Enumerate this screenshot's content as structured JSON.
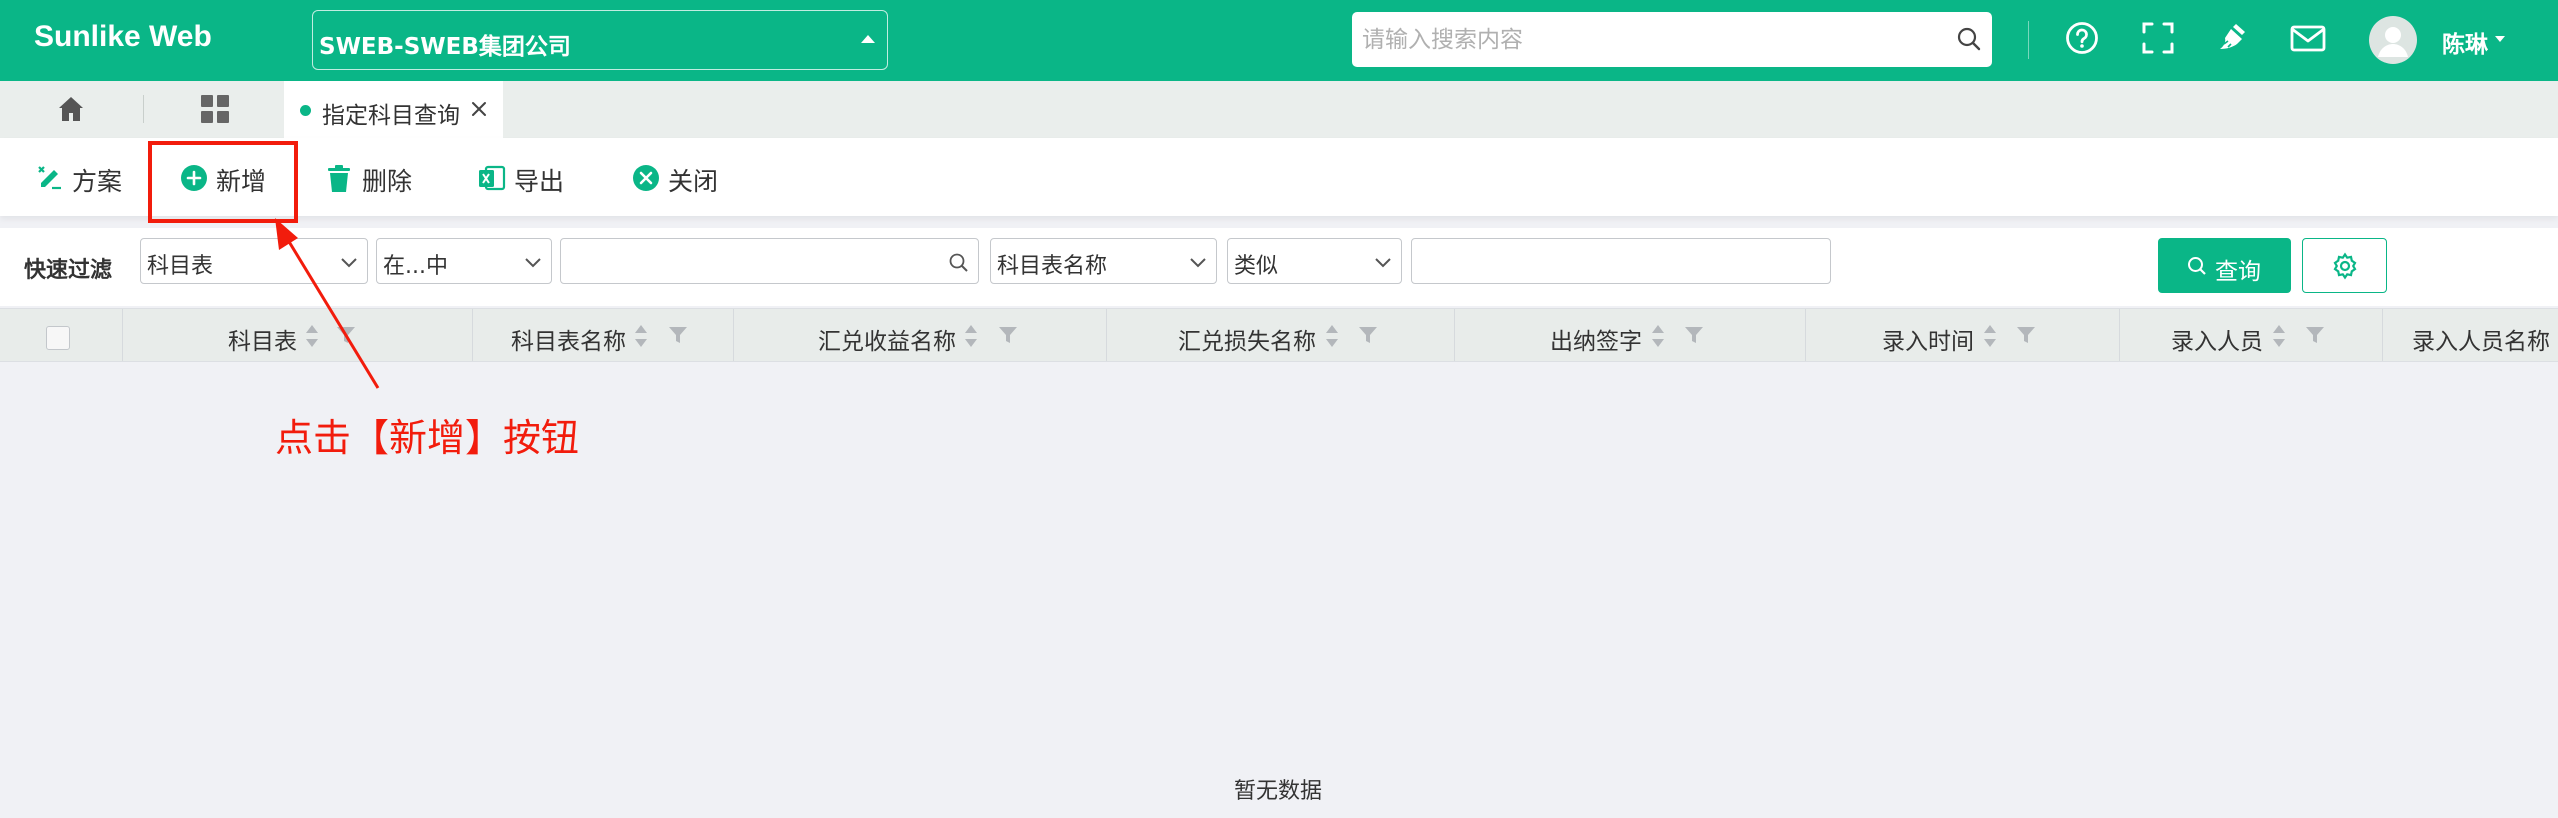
{
  "header": {
    "brand": "Sunlike Web",
    "company": "SWEB-SWEB集团公司",
    "search_placeholder": "请输入搜索内容",
    "icons": [
      "help-icon",
      "fullscreen-icon",
      "clear-cache-icon",
      "mail-icon"
    ],
    "user_name": "陈琳"
  },
  "tabs": {
    "active_label": "指定科目查询"
  },
  "toolbar": {
    "scheme": "方案",
    "add": "新增",
    "delete": "删除",
    "export": "导出",
    "close": "关闭"
  },
  "filter": {
    "label": "快速过滤",
    "field1": "科目表",
    "op1": "在...中",
    "value1": "",
    "field2": "科目表名称",
    "op2": "类似",
    "value2": "",
    "query": "查询"
  },
  "table": {
    "columns": [
      "科目表",
      "科目表名称",
      "汇兑收益名称",
      "汇兑损失名称",
      "出纳签字",
      "录入时间",
      "录入人员",
      "录入人员名称"
    ],
    "empty_text": "暂无数据"
  },
  "annotation": {
    "text": "点击【新增】按钮"
  },
  "colors": {
    "brand": "#0ab687",
    "annotation": "#f21c0c"
  }
}
